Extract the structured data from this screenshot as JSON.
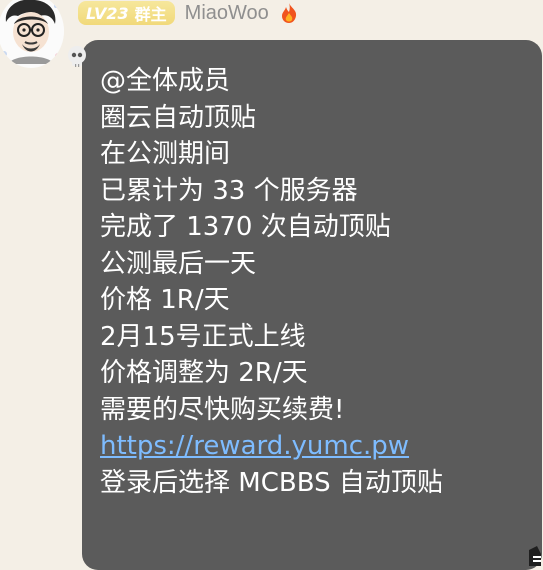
{
  "sender": {
    "level": "LV23",
    "role": "群主",
    "name": "MiaoWoo",
    "avatar_icon": "cartoon-man-avatar-icon",
    "flame_icon": "fire-icon"
  },
  "message": {
    "lines": [
      "@全体成员",
      "圈云自动顶贴",
      "在公测期间",
      "已累计为 33 个服务器",
      "完成了 1370 次自动顶贴",
      "公测最后一天",
      "价格 1R/天",
      "2月15号正式上线",
      "价格调整为 2R/天",
      "需要的尽快购买续费!"
    ],
    "link": "https://reward.yumc.pw",
    "last_line": "登录后选择 MCBBS 自动顶贴"
  },
  "colors": {
    "background": "#f4efe6",
    "bubble": "#5b5b5b",
    "link": "#7ebcff",
    "badge": "#f1d97a"
  }
}
